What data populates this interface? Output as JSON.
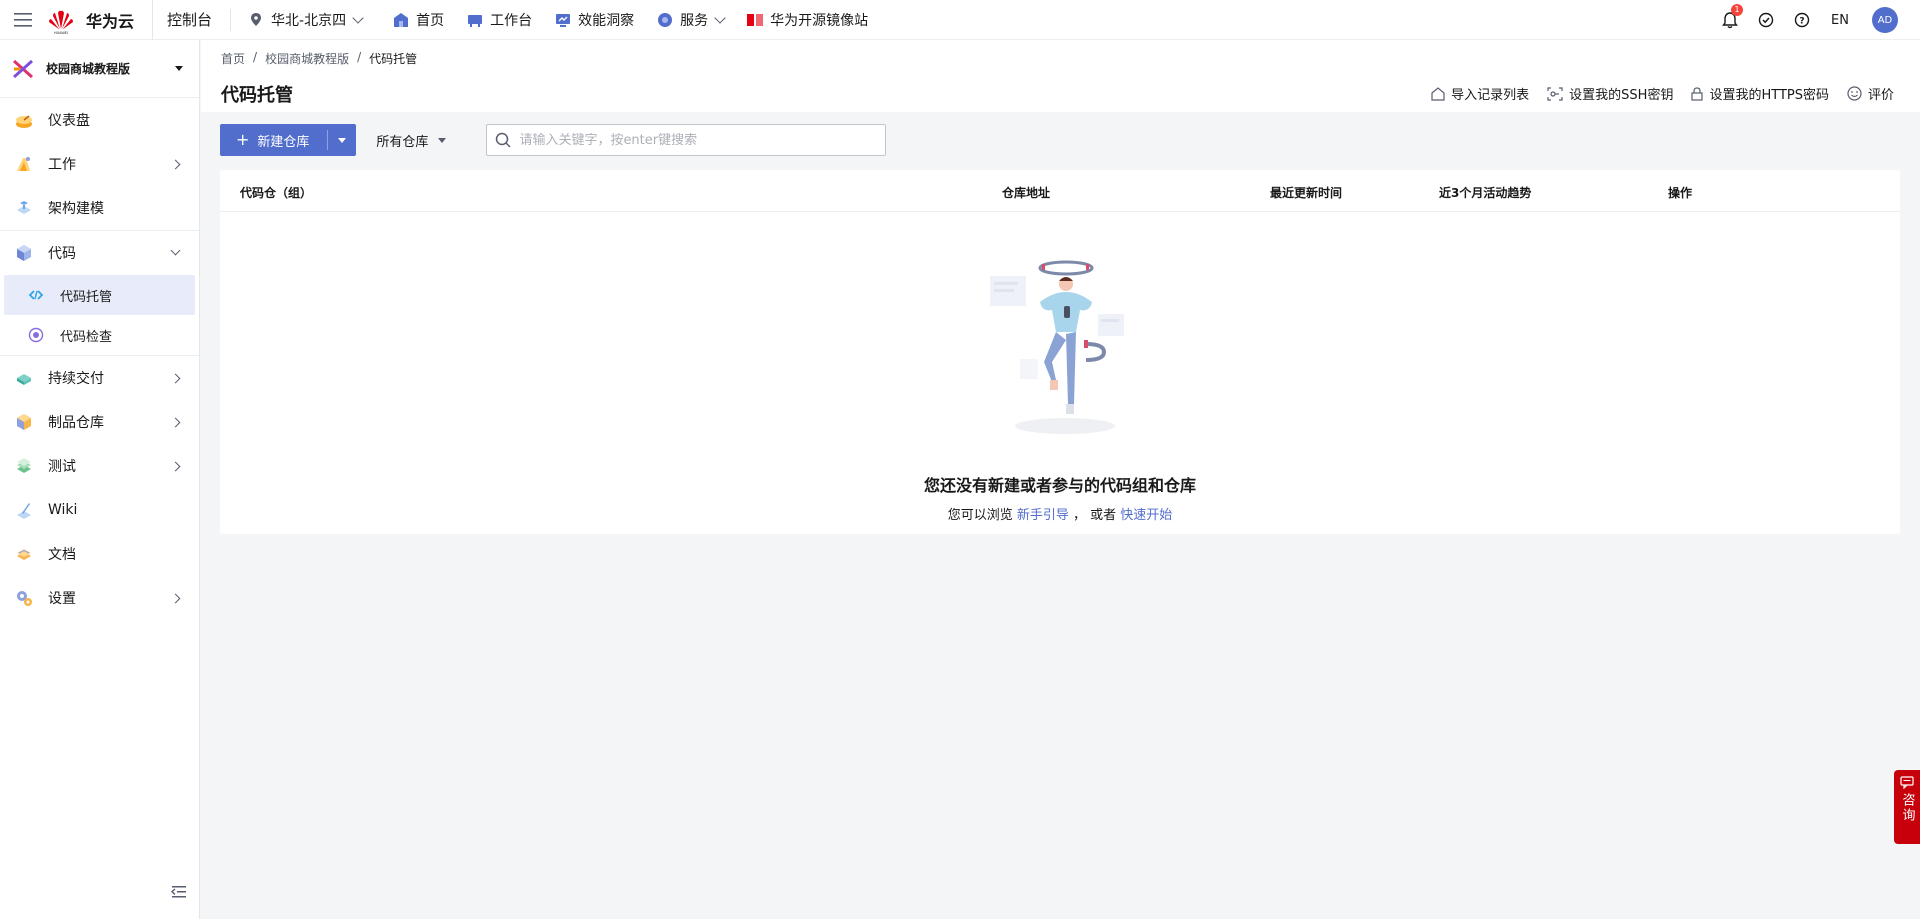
{
  "topbar": {
    "brand": "华为云",
    "console": "控制台",
    "region": "华北-北京四",
    "nav": [
      "首页",
      "工作台",
      "效能洞察",
      "服务",
      "华为开源镜像站"
    ],
    "badge_count": "1",
    "lang": "EN",
    "avatar": "AD"
  },
  "sidebar": {
    "project": "校园商城教程版",
    "items": [
      {
        "label": "仪表盘"
      },
      {
        "label": "工作"
      },
      {
        "label": "架构建模"
      },
      {
        "label": "代码"
      },
      {
        "label": "持续交付"
      },
      {
        "label": "制品仓库"
      },
      {
        "label": "测试"
      },
      {
        "label": "Wiki"
      },
      {
        "label": "文档"
      },
      {
        "label": "设置"
      }
    ],
    "sub_items": [
      {
        "label": "代码托管"
      },
      {
        "label": "代码检查"
      }
    ]
  },
  "breadcrumb": [
    "首页",
    "校园商城教程版",
    "代码托管"
  ],
  "page_title": "代码托管",
  "header_actions": [
    "导入记录列表",
    "设置我的SSH密钥",
    "设置我的HTTPS密码",
    "评价"
  ],
  "toolbar": {
    "new_repo": "新建仓库",
    "filter": "所有仓库",
    "search_placeholder": "请输入关键字，按enter键搜索"
  },
  "table": {
    "columns": [
      "代码仓（组）",
      "仓库地址",
      "最近更新时间",
      "近3个月活动趋势",
      "操作"
    ]
  },
  "empty": {
    "title": "您还没有新建或者参与的代码组和仓库",
    "prefix": "您可以浏览",
    "link1": "新手引导",
    "mid": "，  或者",
    "link2": "快速开始"
  },
  "consult": "咨询",
  "colors": {
    "accent": "#526ecc",
    "brand_red": "#c7000b"
  }
}
